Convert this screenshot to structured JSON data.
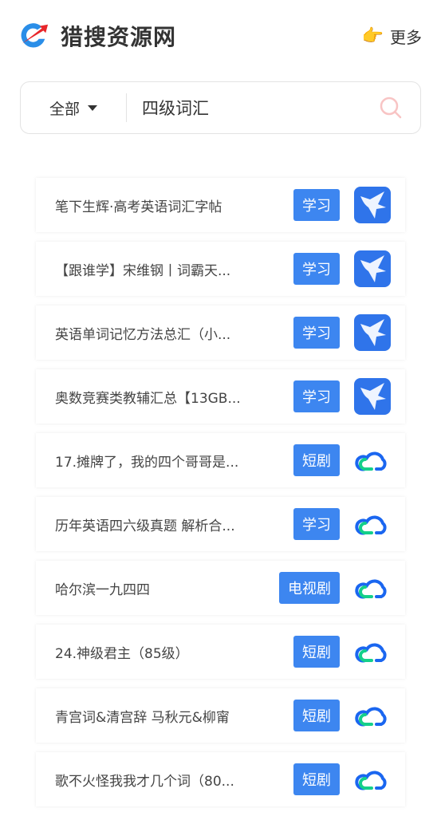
{
  "header": {
    "title": "猎搜资源网",
    "more_label": "更多",
    "more_icon": "pointing-hand-icon"
  },
  "search": {
    "category": "全部",
    "query": "四级词汇"
  },
  "colors": {
    "tag": "#3d86f0",
    "search_icon": "#f8c4c4"
  },
  "results": [
    {
      "name": "笔下生辉·高考英语词汇字帖",
      "tag": "学习",
      "source": "xunlei"
    },
    {
      "name": "【跟谁学】宋维钢丨词霸天...",
      "tag": "学习",
      "source": "xunlei"
    },
    {
      "name": "英语单词记忆方法总汇（小...",
      "tag": "学习",
      "source": "xunlei"
    },
    {
      "name": "奥数竞赛类教辅汇总【13GB...",
      "tag": "学习",
      "source": "xunlei"
    },
    {
      "name": "17.摊牌了，我的四个哥哥是...",
      "tag": "短剧",
      "source": "cloud"
    },
    {
      "name": "历年英语四六级真题 解析合...",
      "tag": "学习",
      "source": "cloud"
    },
    {
      "name": "哈尔滨一九四四",
      "tag": "电视剧",
      "source": "cloud"
    },
    {
      "name": "24.神级君主（85级）",
      "tag": "短剧",
      "source": "cloud"
    },
    {
      "name": "青宫词&清宫辞 马秋元&柳甯",
      "tag": "短剧",
      "source": "cloud"
    },
    {
      "name": "歌不火怪我我才几个词（80...",
      "tag": "短剧",
      "source": "cloud"
    }
  ]
}
